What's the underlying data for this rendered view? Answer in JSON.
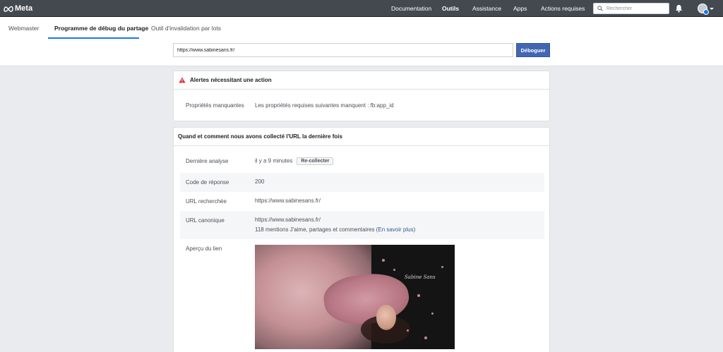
{
  "topbar": {
    "brand": "Meta",
    "nav": [
      "Documentation",
      "Outils",
      "Assistance",
      "Apps",
      "Actions requises"
    ],
    "search_placeholder": "Rechercher"
  },
  "tabs": [
    "Webmaster",
    "Programme de débug du partage",
    "Outil d'invalidation par lots"
  ],
  "url_bar": {
    "value": "https://www.sabinesans.fr/",
    "button": "Déboguer"
  },
  "alerts": {
    "title": "Alertes nécessitant une action",
    "row_label": "Propriétés manquantes",
    "row_value": "Les propriétés requises suivantes manquent : fb:app_id"
  },
  "scrape": {
    "title": "Quand et comment nous avons collecté l'URL la dernière fois",
    "last_scraped_label": "Dernière analyse",
    "last_scraped_value": "il y a 9 minutes",
    "rescrape_button": "Re-collecter",
    "response_code_label": "Code de réponse",
    "response_code_value": "200",
    "fetched_url_label": "URL recherchée",
    "fetched_url_value": "https://www.sabinesans.fr/",
    "canonical_label": "URL canonique",
    "canonical_value": "https://www.sabinesans.fr/",
    "mentions_text": "118 mentions J'aime, partages et commentaires (",
    "learn_more": "En savoir plus",
    "mentions_close": ")",
    "preview_label": "Aperçu du lien",
    "image_signature": "Sabine Sans"
  },
  "colors": {
    "topbar": "#444950",
    "primary_button": "#4267b2",
    "link": "#365899",
    "alert_icon": "#e02f35"
  }
}
